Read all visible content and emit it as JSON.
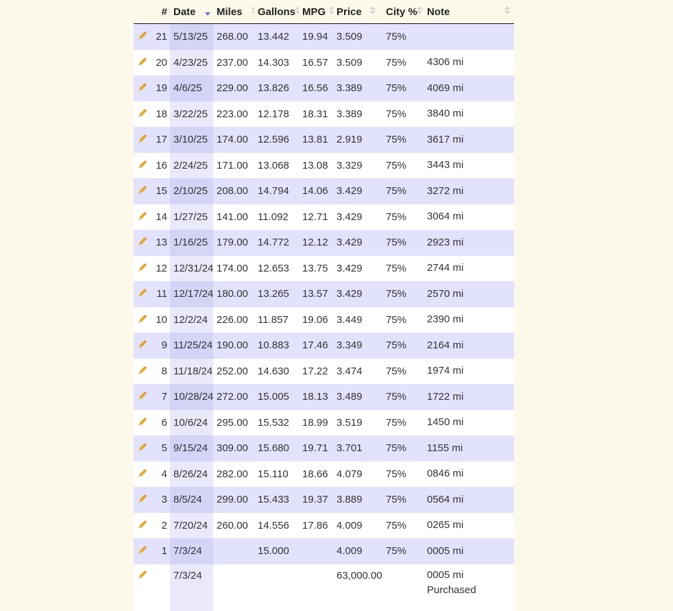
{
  "columns": {
    "num": "#",
    "date": "Date",
    "miles": "Miles",
    "gallons": "Gallons",
    "mpg": "MPG",
    "price": "Price",
    "city": "City %",
    "note": "Note"
  },
  "sort": {
    "column": "Date",
    "direction": "descending"
  },
  "colors": {
    "row_odd": "#e2e2fc",
    "row_even": "#ffffff",
    "sorted_column_odd": "#d4d4f7",
    "sorted_column_even": "#e9e9fb",
    "page_bg": "#fcf9ea",
    "edit_icon": "#f2b61c",
    "sort_arrow_active": "#6a72d6"
  },
  "edit_icon": "pencil-icon",
  "rows": [
    {
      "num": "21",
      "date": "5/13/25",
      "miles": "268.00",
      "gallons": "13.442",
      "mpg": "19.94",
      "price": "3.509",
      "city": "75%",
      "note": ""
    },
    {
      "num": "20",
      "date": "4/23/25",
      "miles": "237.00",
      "gallons": "14.303",
      "mpg": "16.57",
      "price": "3.509",
      "city": "75%",
      "note": "4306 mi"
    },
    {
      "num": "19",
      "date": "4/6/25",
      "miles": "229.00",
      "gallons": "13.826",
      "mpg": "16.56",
      "price": "3.389",
      "city": "75%",
      "note": "4069 mi"
    },
    {
      "num": "18",
      "date": "3/22/25",
      "miles": "223.00",
      "gallons": "12.178",
      "mpg": "18.31",
      "price": "3.389",
      "city": "75%",
      "note": "3840 mi"
    },
    {
      "num": "17",
      "date": "3/10/25",
      "miles": "174.00",
      "gallons": "12.596",
      "mpg": "13.81",
      "price": "2.919",
      "city": "75%",
      "note": "3617 mi"
    },
    {
      "num": "16",
      "date": "2/24/25",
      "miles": "171.00",
      "gallons": "13.068",
      "mpg": "13.08",
      "price": "3.329",
      "city": "75%",
      "note": "3443 mi"
    },
    {
      "num": "15",
      "date": "2/10/25",
      "miles": "208.00",
      "gallons": "14.794",
      "mpg": "14.06",
      "price": "3.429",
      "city": "75%",
      "note": "3272 mi"
    },
    {
      "num": "14",
      "date": "1/27/25",
      "miles": "141.00",
      "gallons": "11.092",
      "mpg": "12.71",
      "price": "3.429",
      "city": "75%",
      "note": "3064 mi"
    },
    {
      "num": "13",
      "date": "1/16/25",
      "miles": "179.00",
      "gallons": "14.772",
      "mpg": "12.12",
      "price": "3.429",
      "city": "75%",
      "note": "2923 mi"
    },
    {
      "num": "12",
      "date": "12/31/24",
      "miles": "174.00",
      "gallons": "12.653",
      "mpg": "13.75",
      "price": "3.429",
      "city": "75%",
      "note": "2744 mi"
    },
    {
      "num": "11",
      "date": "12/17/24",
      "miles": "180.00",
      "gallons": "13.265",
      "mpg": "13.57",
      "price": "3.429",
      "city": "75%",
      "note": "2570 mi"
    },
    {
      "num": "10",
      "date": "12/2/24",
      "miles": "226.00",
      "gallons": "11.857",
      "mpg": "19.06",
      "price": "3.449",
      "city": "75%",
      "note": "2390 mi"
    },
    {
      "num": "9",
      "date": "11/25/24",
      "miles": "190.00",
      "gallons": "10.883",
      "mpg": "17.46",
      "price": "3.349",
      "city": "75%",
      "note": "2164 mi"
    },
    {
      "num": "8",
      "date": "11/18/24",
      "miles": "252.00",
      "gallons": "14.630",
      "mpg": "17.22",
      "price": "3.474",
      "city": "75%",
      "note": "1974 mi"
    },
    {
      "num": "7",
      "date": "10/28/24",
      "miles": "272.00",
      "gallons": "15.005",
      "mpg": "18.13",
      "price": "3.489",
      "city": "75%",
      "note": "1722 mi"
    },
    {
      "num": "6",
      "date": "10/6/24",
      "miles": "295.00",
      "gallons": "15.532",
      "mpg": "18.99",
      "price": "3.519",
      "city": "75%",
      "note": "1450 mi"
    },
    {
      "num": "5",
      "date": "9/15/24",
      "miles": "309.00",
      "gallons": "15.680",
      "mpg": "19.71",
      "price": "3.701",
      "city": "75%",
      "note": "1155 mi"
    },
    {
      "num": "4",
      "date": "8/26/24",
      "miles": "282.00",
      "gallons": "15.110",
      "mpg": "18.66",
      "price": "4.079",
      "city": "75%",
      "note": "0846 mi"
    },
    {
      "num": "3",
      "date": "8/5/24",
      "miles": "299.00",
      "gallons": "15.433",
      "mpg": "19.37",
      "price": "3.889",
      "city": "75%",
      "note": "0564 mi"
    },
    {
      "num": "2",
      "date": "7/20/24",
      "miles": "260.00",
      "gallons": "14.556",
      "mpg": "17.86",
      "price": "4.009",
      "city": "75%",
      "note": "0265 mi"
    },
    {
      "num": "1",
      "date": "7/3/24",
      "miles": "",
      "gallons": "15.000",
      "mpg": "",
      "price": "4.009",
      "city": "75%",
      "note": "0005 mi"
    },
    {
      "num": "",
      "date": "7/3/24",
      "miles": "",
      "gallons": "",
      "mpg": "",
      "price": "63,000.00",
      "city": "",
      "note": "0005 mi",
      "note2": "Purchased"
    }
  ]
}
